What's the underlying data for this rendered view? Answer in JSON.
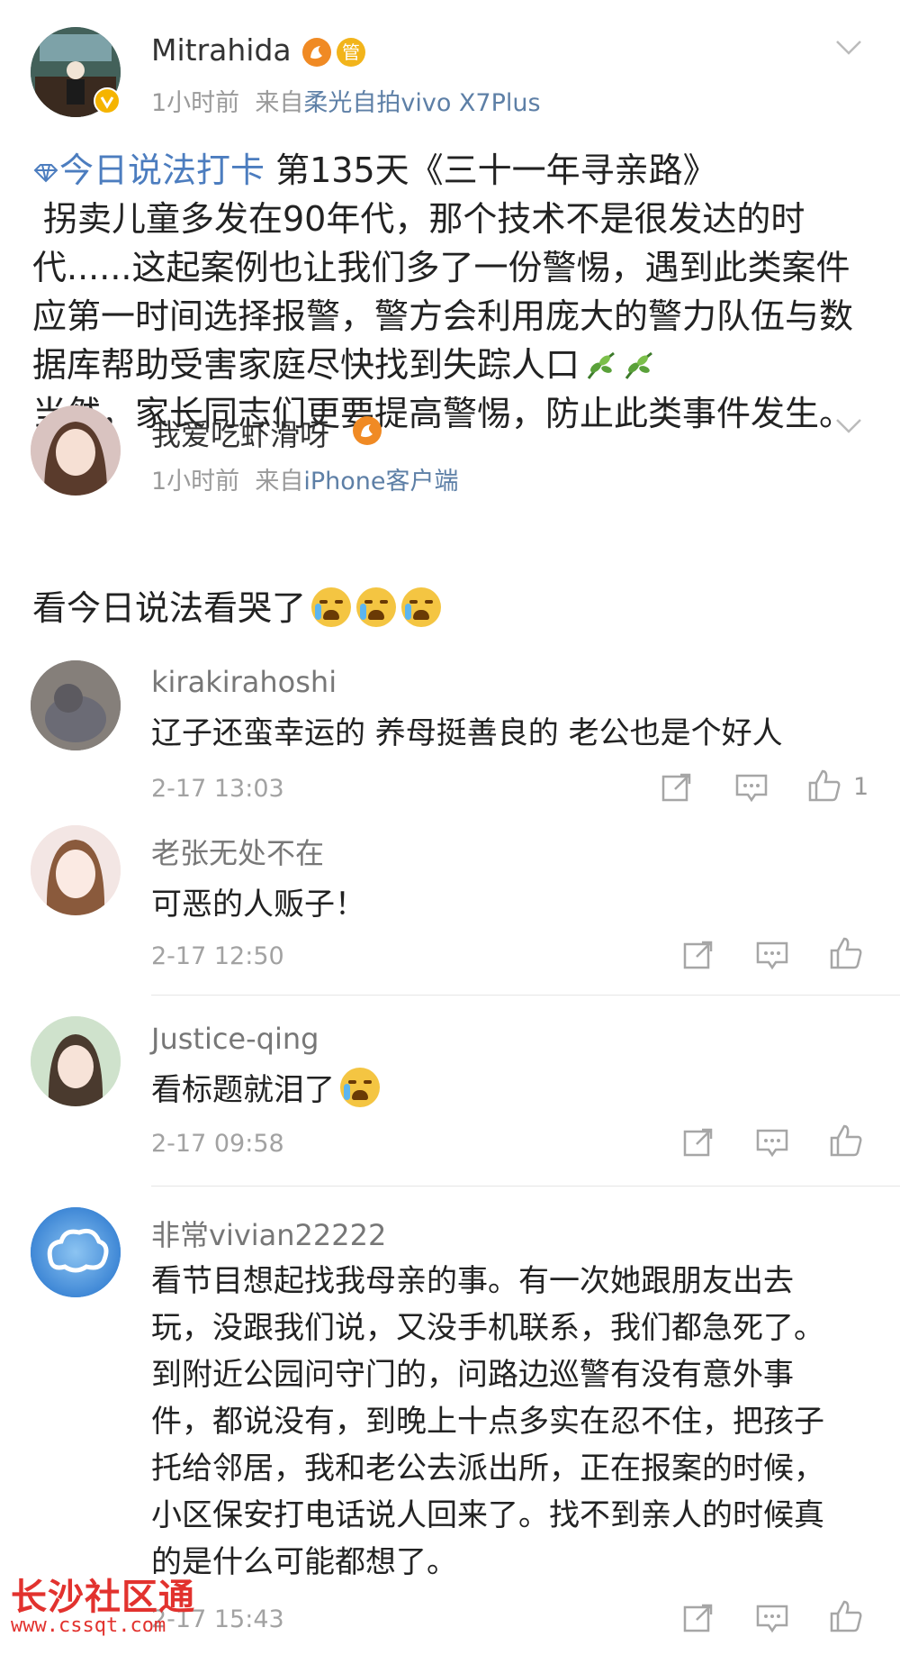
{
  "post": {
    "author": "Mitrahida",
    "time": "1小时前",
    "from_prefix": "来自",
    "source": "柔光自拍vivo X7Plus",
    "badge_text": "管",
    "topic_link": "今日说法打卡",
    "line1_rest": "第135天《三十一年寻亲路》",
    "line2": "拐卖儿童多发在90年代，那个技术不是很发达的时",
    "line3": "代......这起案例也让我们多了一份警惕，遇到此类案件",
    "line4": "应第一时间选择报警，警方会利用庞大的警力队伍与数",
    "line5": "据库帮助受害家庭尽快找到失踪人口",
    "line6": "当然，家长同志们更要提高警惕，防止此类事件发生。"
  },
  "reply": {
    "author": "我爱吃虾滑呀",
    "time": "1小时前",
    "from_prefix": "来自",
    "source": "iPhone客户端",
    "text": "看今日说法看哭了"
  },
  "comments": [
    {
      "author": "kirakirahoshi",
      "text": "辽子还蛮幸运的 养母挺善良的 老公也是个好人",
      "time": "2-17 13:03",
      "likes": "1"
    },
    {
      "author": "老张无处不在",
      "text": "可恶的人贩子！",
      "time": "2-17 12:50",
      "likes": ""
    },
    {
      "author": "Justice-qing",
      "text": "看标题就泪了",
      "time": "2-17 09:58",
      "likes": ""
    },
    {
      "author": "非常vivian22222",
      "lines": [
        "看节目想起找我母亲的事。有一次她跟朋友出去",
        "玩，没跟我们说，又没手机联系，我们都急死了。",
        "到附近公园问守门的，问路边巡警有没有意外事",
        "件，都说没有，到晚上十点多实在忍不住，把孩子",
        "托给邻居，我和老公去派出所，正在报案的时候，",
        "小区保安打电话说人回来了。找不到亲人的时候真",
        "的是什么可能都想了。"
      ],
      "time": "2-17 15:43",
      "likes": ""
    }
  ],
  "watermark": {
    "title": "长沙社区通",
    "url": "www.cssqt.com"
  },
  "colors": {
    "link": "#4c7dbf",
    "source": "#5d7fa6",
    "meta": "#9a9a9a",
    "watermark": "#e2322e"
  }
}
